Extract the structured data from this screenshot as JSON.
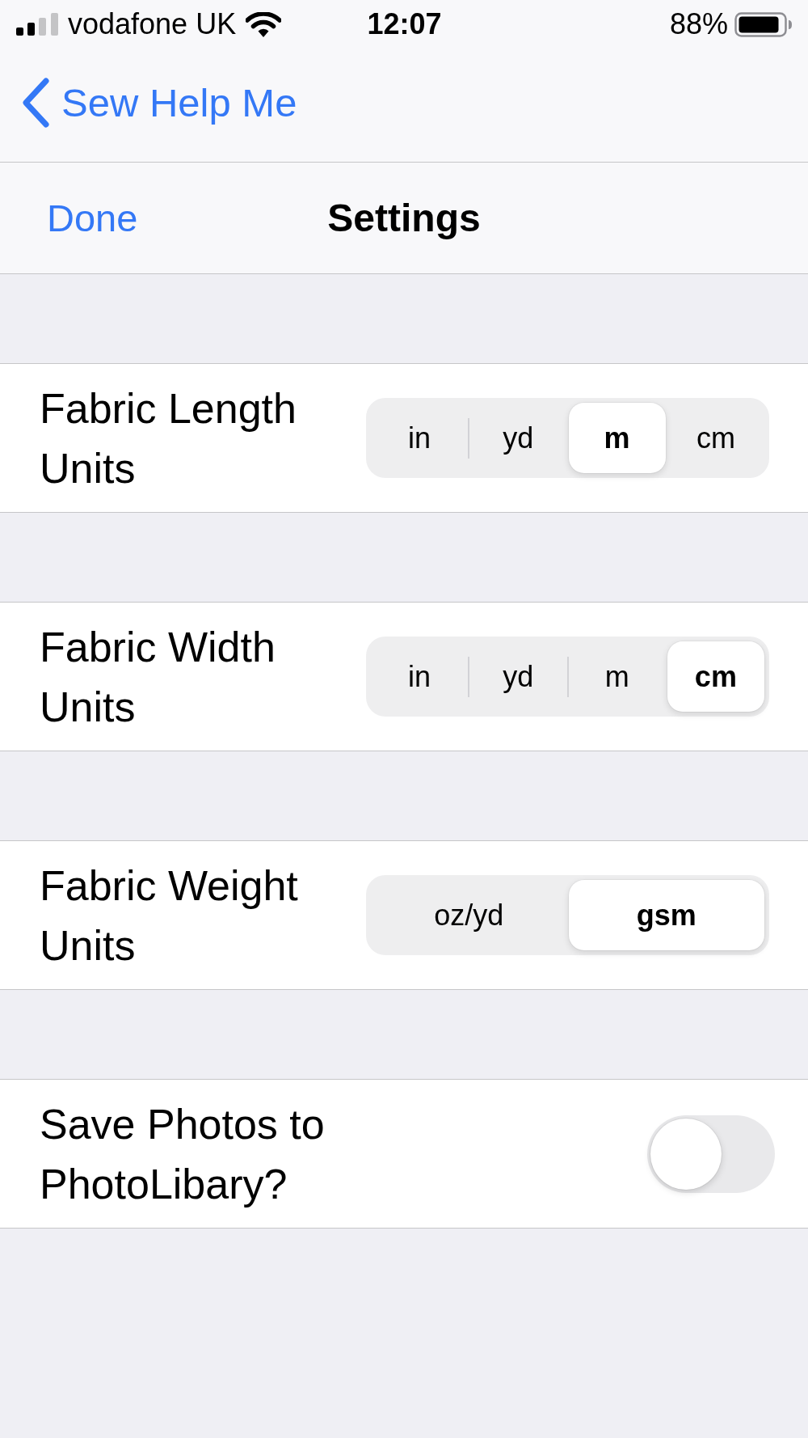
{
  "status_bar": {
    "carrier": "vodafone UK",
    "time": "12:07",
    "battery": "88%"
  },
  "back_button": {
    "label": "Sew Help Me"
  },
  "nav_bar": {
    "left_button": "Done",
    "title": "Settings"
  },
  "settings": [
    {
      "kind": "segmented",
      "label": "Fabric Length Units",
      "options": [
        {
          "label": "in",
          "selected": false
        },
        {
          "label": "yd",
          "selected": false
        },
        {
          "label": "m",
          "selected": true
        },
        {
          "label": "cm",
          "selected": false
        }
      ]
    },
    {
      "kind": "segmented",
      "label": "Fabric Width Units",
      "options": [
        {
          "label": "in",
          "selected": false
        },
        {
          "label": "yd",
          "selected": false
        },
        {
          "label": "m",
          "selected": false
        },
        {
          "label": "cm",
          "selected": true
        }
      ]
    },
    {
      "kind": "segmented",
      "label": "Fabric Weight Units",
      "options": [
        {
          "label": "oz/yd",
          "selected": false
        },
        {
          "label": "gsm",
          "selected": true
        }
      ]
    },
    {
      "kind": "toggle",
      "label": "Save Photos to PhotoLibary?",
      "on": false
    }
  ]
}
